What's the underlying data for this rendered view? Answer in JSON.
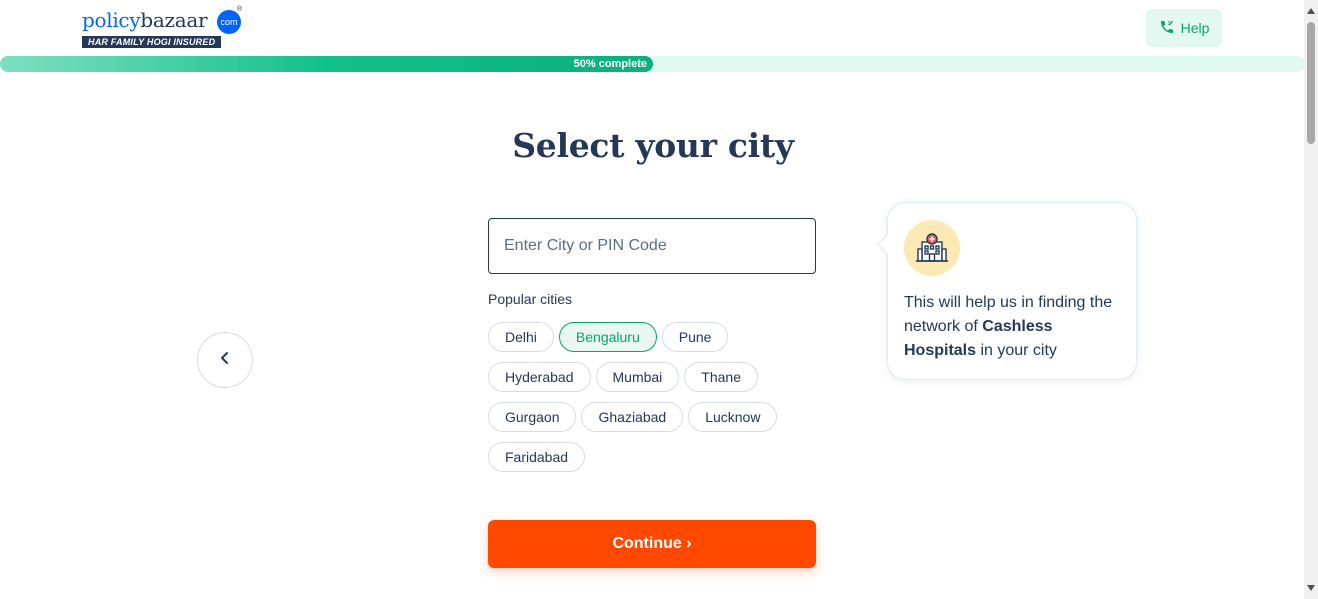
{
  "brand": {
    "name_part1": "policy",
    "name_part2": "bazaar",
    "domain_badge": "com",
    "registered": "®",
    "tagline": "HAR FAMILY HOGI INSURED"
  },
  "header": {
    "help_label": "Help",
    "help_icon": "phone-call-icon"
  },
  "progress": {
    "label": "50% complete",
    "value_percent": 50
  },
  "main": {
    "title": "Select your city",
    "search": {
      "placeholder": "Enter City or PIN Code",
      "value": ""
    },
    "popular_label": "Popular cities",
    "cities": [
      [
        "Delhi",
        "Bengaluru",
        "Pune"
      ],
      [
        "Hyderabad",
        "Mumbai",
        "Thane"
      ],
      [
        "Gurgaon",
        "Ghaziabad",
        "Lucknow"
      ],
      [
        "Faridabad"
      ]
    ],
    "selected_city": "Bengaluru",
    "continue_label": "Continue ›",
    "back_icon": "chevron-left-icon"
  },
  "info": {
    "icon": "hospital-icon",
    "text_before": "This will help us in finding the network of ",
    "text_bold": "Cashless Hospitals",
    "text_after": " in your city"
  },
  "colors": {
    "brand_blue": "#0065ff",
    "navy": "#253858",
    "green": "#0aa36c",
    "cta_orange": "#ff4800"
  }
}
